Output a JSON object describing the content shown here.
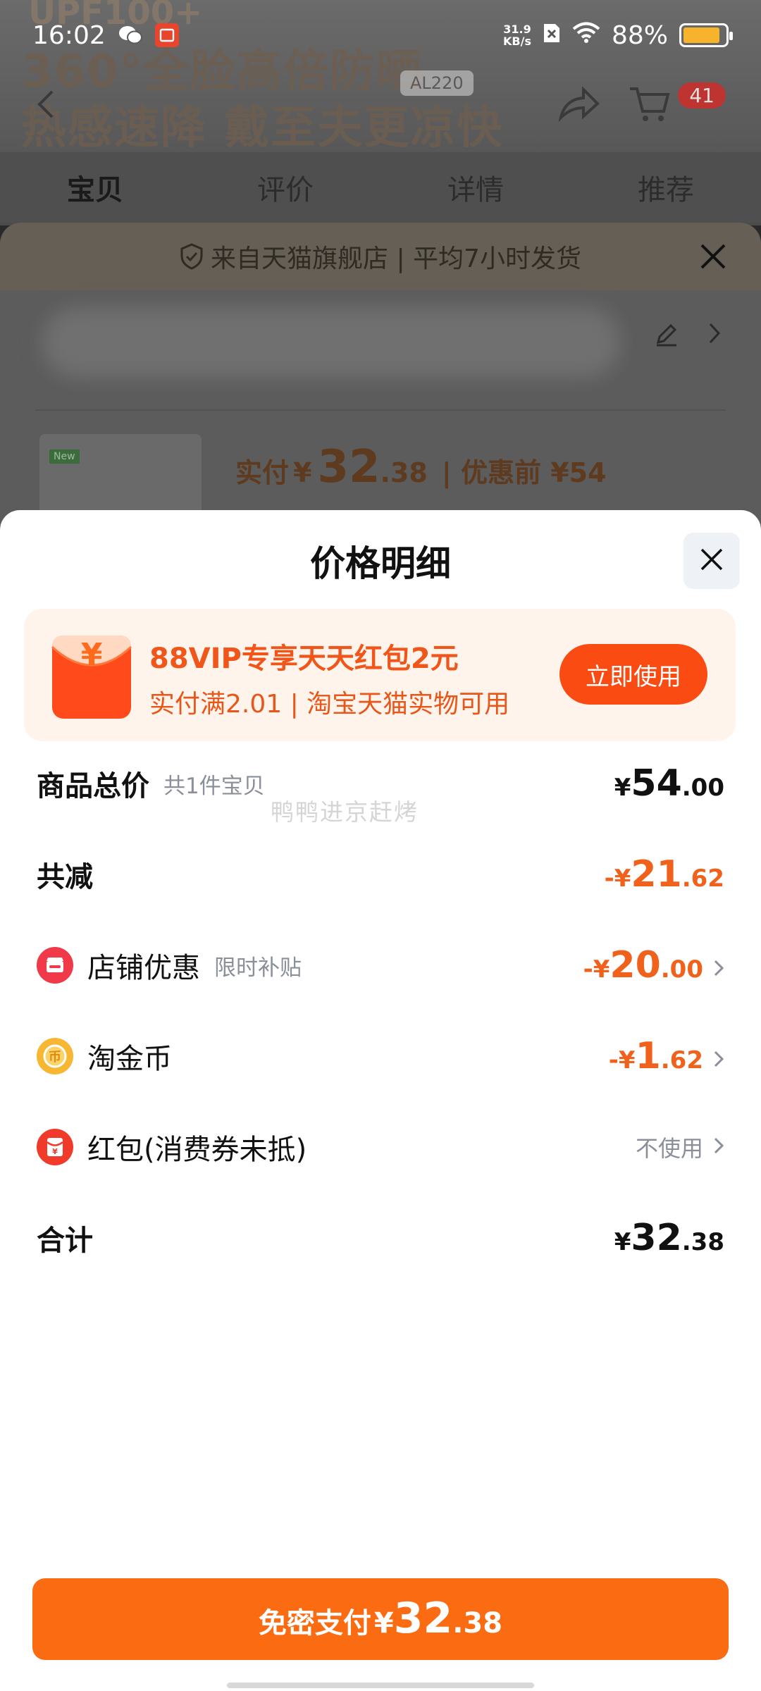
{
  "status_bar": {
    "time": "16:02",
    "net_speed_value": "31.9",
    "net_speed_unit": "KB/s",
    "battery": "88%"
  },
  "background": {
    "hero_line1": "UPF100+",
    "hero_line2": "360°全脸高倍防晒",
    "hero_line3": "热感速降 戴至夫更凉快",
    "hero_badge": "AL220",
    "cart_count": "41",
    "tabs": [
      "宝贝",
      "评价",
      "详情",
      "推荐"
    ],
    "shipping_notice": "来自天猫旗舰店 | 平均7小时发货",
    "paid_label": "实付",
    "paid_symbol": "¥",
    "paid_int": "32",
    "paid_dec": ".38",
    "before_discount": "| 优惠前 ¥54",
    "thumb_tag": "New"
  },
  "sheet": {
    "title": "价格明细",
    "promo": {
      "title": "88VIP专享天天红包2元",
      "subtitle": "实付满2.01 | 淘宝天猫实物可用",
      "button": "立即使用"
    },
    "rows": {
      "total": {
        "label": "商品总价",
        "sub": "共1件宝贝",
        "sym": "¥",
        "int": "54",
        "dec": ".00"
      },
      "reduce": {
        "label": "共减",
        "sym": "-¥",
        "int": "21",
        "dec": ".62"
      },
      "store": {
        "label": "店铺优惠",
        "sub": "限时补贴",
        "sym": "-¥",
        "int": "20",
        "dec": ".00"
      },
      "coin": {
        "label": "淘金币",
        "sym": "-¥",
        "int": "1",
        "dec": ".62"
      },
      "redpacket": {
        "label": "红包(消费券未抵)",
        "value": "不使用"
      },
      "sum": {
        "label": "合计",
        "sym": "¥",
        "int": "32",
        "dec": ".38"
      }
    },
    "watermark": "鸭鸭进京赶烤",
    "pay_button": {
      "label": "免密支付",
      "sym": "¥",
      "int": "32",
      "dec": ".38"
    }
  },
  "colors": {
    "accent_orange": "#fb6b12",
    "price_orange": "#f0611c",
    "promo_bg": "#fff4ec"
  }
}
